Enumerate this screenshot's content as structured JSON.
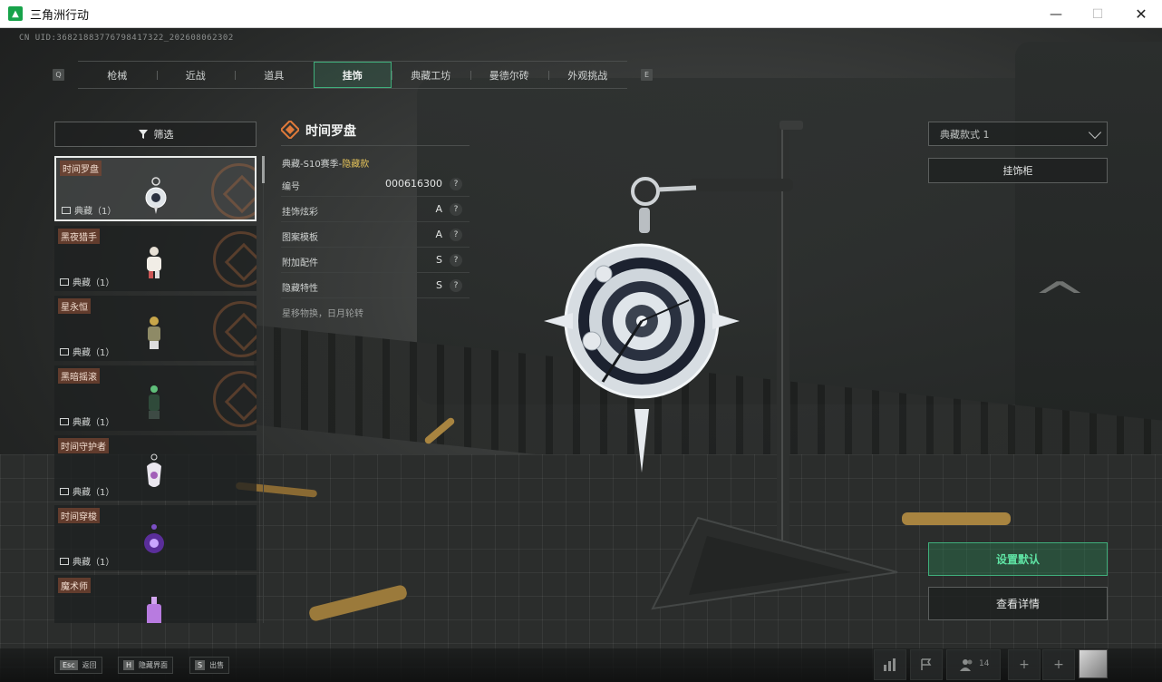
{
  "window": {
    "title": "三角洲行动",
    "min": "—",
    "max": "☐",
    "close": "✕"
  },
  "uid": "CN UID:36821883776798417322_202608062302",
  "tabs": [
    {
      "label": "枪械"
    },
    {
      "label": "近战"
    },
    {
      "label": "道具"
    },
    {
      "label": "挂饰"
    },
    {
      "label": "典藏工坊"
    },
    {
      "label": "曼德尔砖"
    },
    {
      "label": "外观挑战"
    }
  ],
  "tab_keys": {
    "left": "Q",
    "right": "E"
  },
  "filter": {
    "label": "筛选",
    "icon": "filter-icon"
  },
  "items": [
    {
      "name": "时间罗盘",
      "tag": "典藏（1）"
    },
    {
      "name": "黑夜猎手",
      "tag": "典藏（1）"
    },
    {
      "name": "星永恒",
      "tag": "典藏（1）"
    },
    {
      "name": "黑暗摇滚",
      "tag": "典藏（1）"
    },
    {
      "name": "时间守护者",
      "tag": "典藏（1）"
    },
    {
      "name": "时间穿梭",
      "tag": "典藏（1）"
    },
    {
      "name": "魔术师",
      "tag": ""
    }
  ],
  "detail": {
    "title": "时间罗盘",
    "subtitle_prefix": "典藏-S10赛季-",
    "subtitle_tag": "隐藏款",
    "rows": [
      {
        "key": "编号",
        "value": "000616300"
      },
      {
        "key": "挂饰炫彩",
        "value": "A"
      },
      {
        "key": "图案模板",
        "value": "A"
      },
      {
        "key": "附加配件",
        "value": "S"
      },
      {
        "key": "隐藏特性",
        "value": "S"
      }
    ],
    "help": "?",
    "flavor": "星移物换，日月轮转"
  },
  "right": {
    "style_select": "典藏款式 1",
    "cabinet": "挂饰柜",
    "set_default": "设置默认",
    "view_details": "查看详情"
  },
  "bottom": {
    "hints": [
      {
        "key": "Esc",
        "label": "返回"
      },
      {
        "key": "H",
        "label": "隐藏界面"
      },
      {
        "key": "S",
        "label": "出售"
      }
    ],
    "friend_count": "14",
    "add": "+"
  },
  "colors": {
    "accent_green": "#3fae7b",
    "hidden_gold": "#e2c15a",
    "orange": "#e07a3a"
  }
}
